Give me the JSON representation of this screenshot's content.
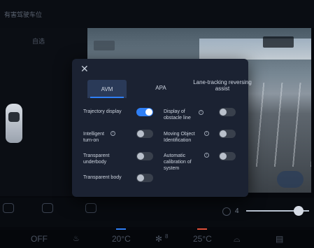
{
  "background": {
    "title": "有害驾驶车位",
    "left_tab": "自选",
    "climate": {
      "fan": "OFF",
      "left_temp": "20°C",
      "fan_level": "8",
      "right_temp": "25°C"
    },
    "volume": "4"
  },
  "dialog": {
    "tabs": [
      {
        "label": "AVM",
        "active": true
      },
      {
        "label": "APA",
        "active": false
      },
      {
        "label": "Lane-tracking reversing assist",
        "active": false
      }
    ],
    "settings": [
      {
        "label": "Trajectory display",
        "info": false,
        "on": true
      },
      {
        "label": "Display of obstacle line",
        "info": true,
        "on": false
      },
      {
        "label": "Intelligent turn-on",
        "info": true,
        "on": false
      },
      {
        "label": "Moving Object Identification",
        "info": true,
        "on": false
      },
      {
        "label": "Transparent underbody",
        "info": false,
        "on": false
      },
      {
        "label": "Automatic calibration of system",
        "info": true,
        "on": false
      },
      {
        "label": "Transparent body",
        "info": false,
        "on": false
      }
    ]
  },
  "colors": {
    "accent": "#2f7ff5",
    "dialog_bg": "#1b2232",
    "toggle_off": "#39404c"
  }
}
